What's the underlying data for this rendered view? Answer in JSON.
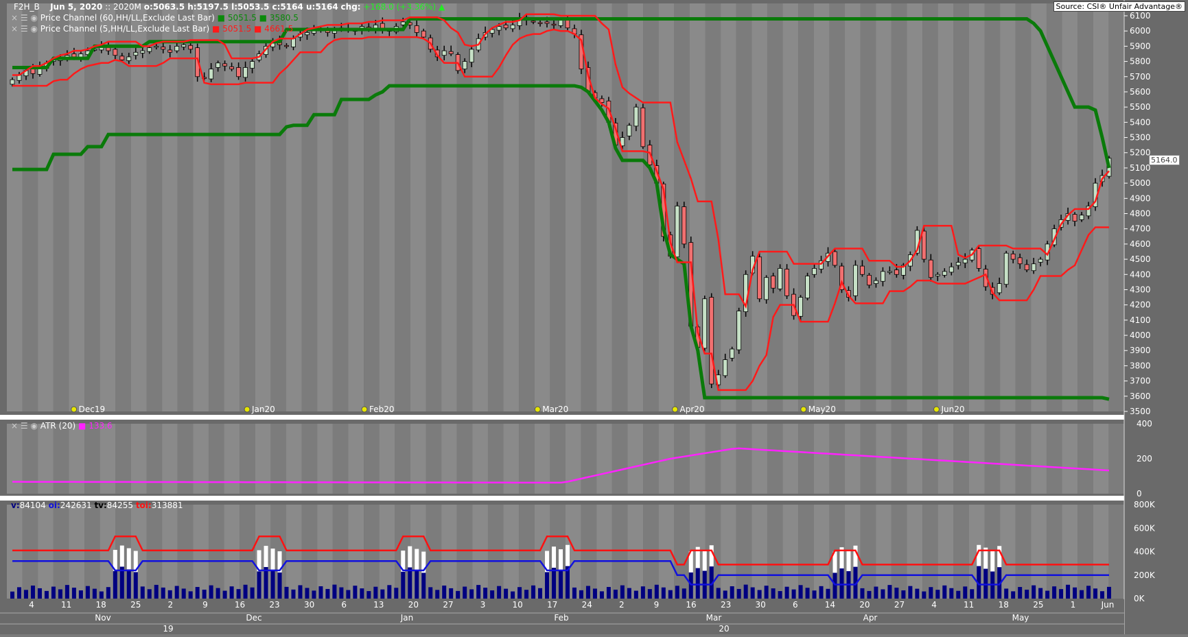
{
  "header": {
    "symbol": "F2H_B",
    "date": "Jun  5, 2020",
    "contract": ":: 2020M",
    "ohlc": "o:5063.5 h:5197.5 l:5053.5 c:5164 u:5164",
    "chg_label": "chg:",
    "chg_value": "+168.0 (+3.36%)",
    "source": "Source: CSI® Unfair Advantage®"
  },
  "indicators": {
    "pc60": {
      "label": "Price Channel (60,HH/LL,Exclude Last Bar)",
      "upper": "5051.5",
      "lower": "3580.5",
      "color": "#0a7a0a"
    },
    "pc5": {
      "label": "Price Channel (5,HH/LL,Exclude Last Bar)",
      "upper": "5051.5",
      "lower": "4661.5",
      "color": "#ff1a1a"
    },
    "atr": {
      "label": "ATR (20)",
      "value": "133.6",
      "color": "#ff22ff"
    },
    "volume": {
      "v_label": "v:",
      "v": "84104",
      "oi_label": "oi:",
      "oi": "242631",
      "tv_label": "tv:",
      "tv": "84255",
      "toi_label": "toi:",
      "toi": "313881"
    }
  },
  "last_price_tag": "5164.0",
  "colors": {
    "up": "#c6e0c6",
    "down": "#f07070",
    "bg_dark": "#6e6e6e",
    "bg_light": "#8a8a8a",
    "oi": "#1111dd",
    "toi": "#ff1111",
    "vol_bar": "#000080"
  },
  "chart_data": [
    {
      "type": "candlestick",
      "panel": "price",
      "ylim": [
        3500,
        6100
      ],
      "yticks": [
        "6100",
        "6000",
        "5900",
        "5800",
        "5700",
        "5600",
        "5500",
        "5400",
        "5300",
        "5200",
        "5100",
        "5000",
        "4900",
        "4800",
        "4700",
        "4600",
        "4500",
        "4400",
        "4300",
        "4200",
        "4100",
        "4000",
        "3900",
        "3800",
        "3700",
        "3600",
        "3500"
      ],
      "month_markers": [
        "Dec19",
        "Jan20",
        "Feb20",
        "Mar20",
        "Apr20",
        "May20",
        "Jun20"
      ],
      "close": [
        5680,
        5710,
        5740,
        5720,
        5760,
        5790,
        5810,
        5820,
        5840,
        5830,
        5850,
        5870,
        5880,
        5900,
        5870,
        5840,
        5810,
        5830,
        5860,
        5870,
        5890,
        5900,
        5880,
        5860,
        5900,
        5910,
        5880,
        5700,
        5690,
        5750,
        5790,
        5770,
        5750,
        5700,
        5760,
        5800,
        5850,
        5900,
        5920,
        5910,
        5900,
        5950,
        5980,
        5990,
        6000,
        6010,
        5990,
        6000,
        6020,
        6010,
        6000,
        6030,
        6010,
        6040,
        6010,
        6000,
        6030,
        6060,
        6040,
        5990,
        5960,
        5880,
        5830,
        5870,
        5850,
        5740,
        5800,
        5880,
        5950,
        5990,
        6010,
        6030,
        6020,
        6040,
        6080,
        6070,
        6060,
        6050,
        6050,
        6040,
        6070,
        6020,
        5980,
        5750,
        5600,
        5560,
        5530,
        5400,
        5250,
        5300,
        5380,
        5500,
        5240,
        5120,
        5000,
        4650,
        4520,
        4850,
        4600,
        4060,
        3920,
        4240,
        3680,
        3740,
        3840,
        3910,
        4160,
        4400,
        4520,
        4240,
        4380,
        4310,
        4440,
        4260,
        4130,
        4250,
        4390,
        4440,
        4490,
        4540,
        4460,
        4300,
        4250,
        4460,
        4400,
        4330,
        4360,
        4420,
        4420,
        4400,
        4460,
        4530,
        4690,
        4500,
        4380,
        4400,
        4420,
        4450,
        4480,
        4500,
        4560,
        4440,
        4320,
        4270,
        4340,
        4540,
        4500,
        4470,
        4430,
        4470,
        4500,
        4600,
        4700,
        4760,
        4800,
        4750,
        4790,
        4850,
        5000,
        5050,
        5164
      ],
      "upper_channel_60": [
        5090,
        5090,
        5090,
        5090,
        5090,
        5090,
        5190,
        5190,
        5190,
        5190,
        5190,
        5240,
        5240,
        5240,
        5320,
        5320,
        5320,
        5320,
        5320,
        5320,
        5320,
        5320,
        5320,
        5320,
        5320,
        5320,
        5320,
        5320,
        5320,
        5320,
        5320,
        5320,
        5320,
        5320,
        5320,
        5320,
        5320,
        5320,
        5320,
        5320,
        5370,
        5380,
        5380,
        5380,
        5450,
        5450,
        5450,
        5450,
        5550,
        5550,
        5550,
        5550,
        5550,
        5580,
        5600,
        5640,
        5640,
        5640,
        5640,
        5640,
        5640,
        5640,
        5640,
        5640,
        5640,
        5640,
        5640,
        5640,
        5640,
        5640,
        5640,
        5640,
        5640,
        5640,
        5640,
        5640,
        5640,
        5640,
        5640,
        5640,
        5640,
        5640,
        5640,
        5630,
        5600,
        5540,
        5480,
        5400,
        5230,
        5150,
        5150,
        5150,
        5150,
        5100,
        5000,
        4700,
        4530,
        4500,
        4470,
        4060,
        3900,
        3590,
        3590,
        3590,
        3590,
        3590,
        3590,
        3590,
        3590,
        3590,
        3590,
        3590,
        3590,
        3590,
        3590,
        3590,
        3590,
        3590,
        3590,
        3590,
        3590,
        3590,
        3590,
        3590,
        3590,
        3590,
        3590,
        3590,
        3590,
        3590,
        3590,
        3590,
        3590,
        3590,
        3590,
        3590,
        3590,
        3590,
        3590,
        3590,
        3590,
        3590,
        3590,
        3590,
        3590,
        3590,
        3590,
        3590,
        3590,
        3590,
        3590,
        3590,
        3590,
        3590,
        3590,
        3590,
        3590,
        3590,
        3590,
        3590,
        3580
      ],
      "range_upper_60": [
        6080,
        6050,
        6000,
        5900,
        5800,
        5700,
        5600,
        5500,
        5500,
        5500,
        5480,
        5300,
        5100,
        5051
      ],
      "volume_panel": {
        "ylim": [
          0,
          800000
        ],
        "yticks": [
          "800K",
          "600K",
          "400K",
          "200K",
          "0K"
        ]
      },
      "atr_panel": {
        "ylim": [
          0,
          400
        ],
        "yticks": [
          "400",
          "200",
          "0"
        ]
      },
      "x_day_ticks": [
        "4",
        "11",
        "18",
        "25",
        "2",
        "9",
        "16",
        "23",
        "30",
        "6",
        "13",
        "20",
        "27",
        "3",
        "10",
        "17",
        "24",
        "2",
        "9",
        "16",
        "23",
        "30",
        "6",
        "14",
        "20",
        "27",
        "4",
        "11",
        "18",
        "25",
        "1",
        "Jun"
      ],
      "x_months": [
        "Nov",
        "Dec",
        "Jan",
        "Feb",
        "Mar",
        "Apr",
        "May"
      ],
      "x_years": [
        "19",
        "20"
      ]
    }
  ]
}
